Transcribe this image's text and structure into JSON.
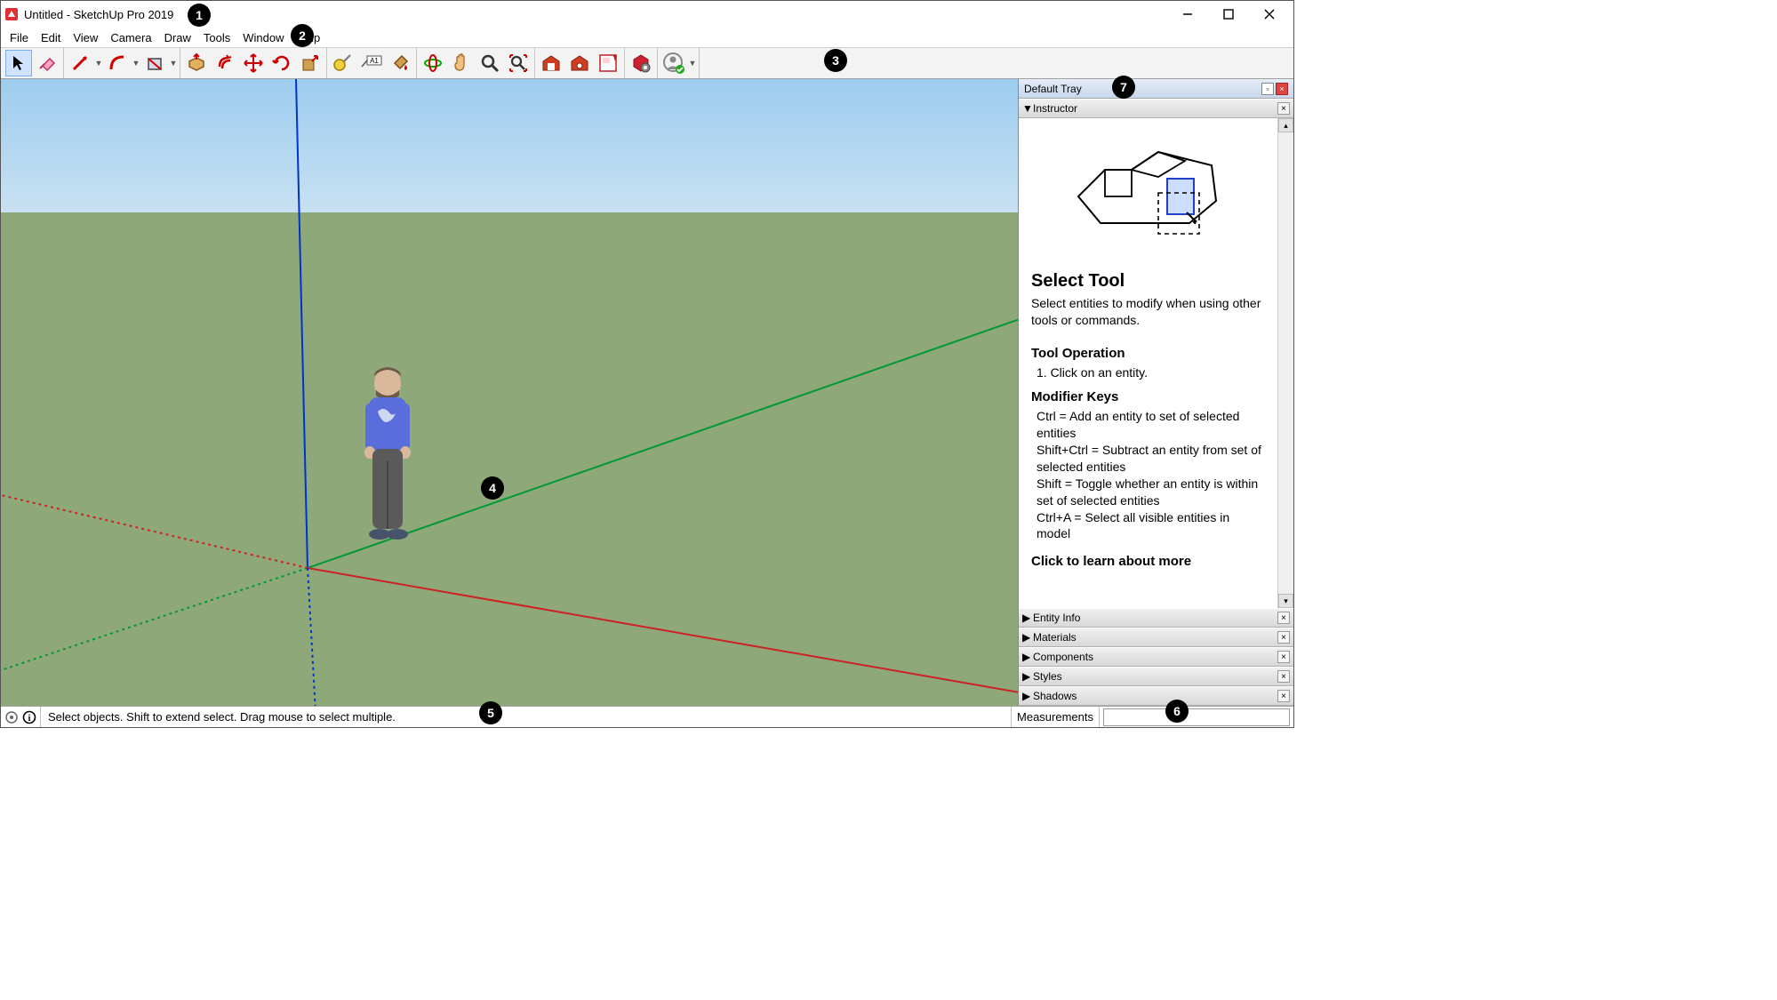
{
  "titlebar": {
    "title": "Untitled - SketchUp Pro 2019"
  },
  "menus": [
    "File",
    "Edit",
    "View",
    "Camera",
    "Draw",
    "Tools",
    "Window",
    "Help"
  ],
  "toolbar_icons": [
    {
      "name": "select-tool-icon",
      "title": "Select",
      "selected": true
    },
    {
      "name": "eraser-tool-icon",
      "title": "Eraser"
    },
    {
      "name": "line-tool-icon",
      "title": "Lines",
      "dropdown": true
    },
    {
      "name": "arc-tool-icon",
      "title": "Arcs",
      "dropdown": true
    },
    {
      "name": "rectangle-tool-icon",
      "title": "Shapes",
      "dropdown": true
    },
    {
      "name": "pushpull-tool-icon",
      "title": "Push/Pull"
    },
    {
      "name": "offset-tool-icon",
      "title": "Offset"
    },
    {
      "name": "move-tool-icon",
      "title": "Move"
    },
    {
      "name": "rotate-tool-icon",
      "title": "Rotate"
    },
    {
      "name": "scale-tool-icon",
      "title": "Scale"
    },
    {
      "name": "tape-measure-tool-icon",
      "title": "Tape Measure"
    },
    {
      "name": "text-tool-icon",
      "title": "Text"
    },
    {
      "name": "paintbucket-tool-icon",
      "title": "Paint Bucket"
    },
    {
      "name": "orbit-tool-icon",
      "title": "Orbit"
    },
    {
      "name": "pan-tool-icon",
      "title": "Pan"
    },
    {
      "name": "zoom-tool-icon",
      "title": "Zoom"
    },
    {
      "name": "zoom-extents-tool-icon",
      "title": "Zoom Extents"
    },
    {
      "name": "warehouse3d-icon",
      "title": "3D Warehouse"
    },
    {
      "name": "extension-warehouse-icon",
      "title": "Extension Warehouse"
    },
    {
      "name": "layout-icon",
      "title": "LayOut"
    },
    {
      "name": "extension-manager-icon",
      "title": "Extension Manager"
    },
    {
      "name": "signin-icon",
      "title": "Sign In",
      "dropdown": true
    }
  ],
  "tray": {
    "title": "Default Tray",
    "instructor": {
      "title": "Instructor",
      "heading": "Select Tool",
      "description": "Select entities to modify when using other tools or commands.",
      "operation_heading": "Tool Operation",
      "operation_step": "1. Click on an entity.",
      "modifier_heading": "Modifier Keys",
      "modifiers": [
        "Ctrl = Add an entity to set of selected entities",
        "Shift+Ctrl = Subtract an entity from set of selected entities",
        "Shift = Toggle whether an entity is within set of selected entities",
        "Ctrl+A = Select all visible entities in model"
      ],
      "learn_more": "Click to learn about more"
    },
    "panels": [
      "Entity Info",
      "Materials",
      "Components",
      "Styles",
      "Shadows"
    ]
  },
  "statusbar": {
    "hint": "Select objects. Shift to extend select. Drag mouse to select multiple.",
    "measurements_label": "Measurements"
  },
  "callouts": [
    "1",
    "2",
    "3",
    "4",
    "5",
    "6",
    "7"
  ]
}
